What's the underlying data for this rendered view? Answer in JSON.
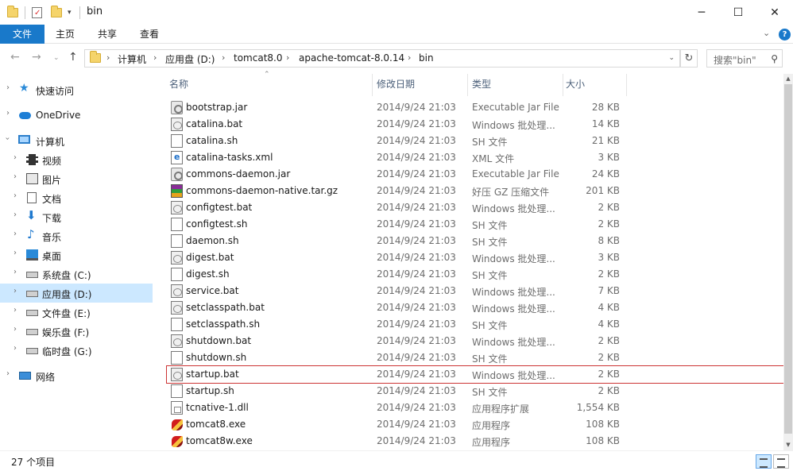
{
  "window": {
    "title": "bin",
    "minimize": "─",
    "maximize": "☐",
    "close": "✕"
  },
  "ribbon": {
    "tabs": [
      "文件",
      "主页",
      "共享",
      "查看"
    ]
  },
  "address": {
    "crumbs": [
      "计算机",
      "应用盘 (D:)",
      "tomcat8.0",
      "apache-tomcat-8.0.14",
      "bin"
    ],
    "search_placeholder": "搜索\"bin\""
  },
  "sidebar": {
    "items": [
      {
        "label": "快速访问",
        "icon": "star-icon"
      },
      {
        "label": "OneDrive",
        "icon": "cloud-icon"
      },
      {
        "label": "计算机",
        "icon": "computer-icon"
      },
      {
        "label": "视频",
        "icon": "video-icon"
      },
      {
        "label": "图片",
        "icon": "picture-icon"
      },
      {
        "label": "文档",
        "icon": "document-icon"
      },
      {
        "label": "下载",
        "icon": "download-icon"
      },
      {
        "label": "音乐",
        "icon": "music-icon"
      },
      {
        "label": "桌面",
        "icon": "desktop-icon"
      },
      {
        "label": "系统盘 (C:)",
        "icon": "drive-icon"
      },
      {
        "label": "应用盘 (D:)",
        "icon": "drive-icon"
      },
      {
        "label": "文件盘 (E:)",
        "icon": "drive-icon"
      },
      {
        "label": "娱乐盘 (F:)",
        "icon": "drive-icon"
      },
      {
        "label": "临时盘 (G:)",
        "icon": "drive-icon"
      },
      {
        "label": "网络",
        "icon": "network-icon"
      }
    ]
  },
  "columns": {
    "name": "名称",
    "date": "修改日期",
    "type": "类型",
    "size": "大小"
  },
  "files": [
    {
      "name": "bootstrap.jar",
      "date": "2014/9/24 21:03",
      "type": "Executable Jar File",
      "size": "28 KB",
      "icon": "jar-icon"
    },
    {
      "name": "catalina.bat",
      "date": "2014/9/24 21:03",
      "type": "Windows 批处理...",
      "size": "14 KB",
      "icon": "bat-icon"
    },
    {
      "name": "catalina.sh",
      "date": "2014/9/24 21:03",
      "type": "SH 文件",
      "size": "21 KB",
      "icon": "sh-icon"
    },
    {
      "name": "catalina-tasks.xml",
      "date": "2014/9/24 21:03",
      "type": "XML 文件",
      "size": "3 KB",
      "icon": "xml-icon"
    },
    {
      "name": "commons-daemon.jar",
      "date": "2014/9/24 21:03",
      "type": "Executable Jar File",
      "size": "24 KB",
      "icon": "jar-icon"
    },
    {
      "name": "commons-daemon-native.tar.gz",
      "date": "2014/9/24 21:03",
      "type": "好压 GZ 压缩文件",
      "size": "201 KB",
      "icon": "archive-icon"
    },
    {
      "name": "configtest.bat",
      "date": "2014/9/24 21:03",
      "type": "Windows 批处理...",
      "size": "2 KB",
      "icon": "bat-icon"
    },
    {
      "name": "configtest.sh",
      "date": "2014/9/24 21:03",
      "type": "SH 文件",
      "size": "2 KB",
      "icon": "sh-icon"
    },
    {
      "name": "daemon.sh",
      "date": "2014/9/24 21:03",
      "type": "SH 文件",
      "size": "8 KB",
      "icon": "sh-icon"
    },
    {
      "name": "digest.bat",
      "date": "2014/9/24 21:03",
      "type": "Windows 批处理...",
      "size": "3 KB",
      "icon": "bat-icon"
    },
    {
      "name": "digest.sh",
      "date": "2014/9/24 21:03",
      "type": "SH 文件",
      "size": "2 KB",
      "icon": "sh-icon"
    },
    {
      "name": "service.bat",
      "date": "2014/9/24 21:03",
      "type": "Windows 批处理...",
      "size": "7 KB",
      "icon": "bat-icon"
    },
    {
      "name": "setclasspath.bat",
      "date": "2014/9/24 21:03",
      "type": "Windows 批处理...",
      "size": "4 KB",
      "icon": "bat-icon"
    },
    {
      "name": "setclasspath.sh",
      "date": "2014/9/24 21:03",
      "type": "SH 文件",
      "size": "4 KB",
      "icon": "sh-icon"
    },
    {
      "name": "shutdown.bat",
      "date": "2014/9/24 21:03",
      "type": "Windows 批处理...",
      "size": "2 KB",
      "icon": "bat-icon"
    },
    {
      "name": "shutdown.sh",
      "date": "2014/9/24 21:03",
      "type": "SH 文件",
      "size": "2 KB",
      "icon": "sh-icon"
    },
    {
      "name": "startup.bat",
      "date": "2014/9/24 21:03",
      "type": "Windows 批处理...",
      "size": "2 KB",
      "icon": "bat-icon"
    },
    {
      "name": "startup.sh",
      "date": "2014/9/24 21:03",
      "type": "SH 文件",
      "size": "2 KB",
      "icon": "sh-icon"
    },
    {
      "name": "tcnative-1.dll",
      "date": "2014/9/24 21:03",
      "type": "应用程序扩展",
      "size": "1,554 KB",
      "icon": "dll-icon"
    },
    {
      "name": "tomcat8.exe",
      "date": "2014/9/24 21:03",
      "type": "应用程序",
      "size": "108 KB",
      "icon": "exe-icon"
    },
    {
      "name": "tomcat8w.exe",
      "date": "2014/9/24 21:03",
      "type": "应用程序",
      "size": "108 KB",
      "icon": "exe-icon"
    }
  ],
  "status": {
    "count": "27 个项目"
  },
  "colors": {
    "accent": "#1979ca",
    "selection": "#cce8ff",
    "highlight_box": "#cc3333"
  }
}
